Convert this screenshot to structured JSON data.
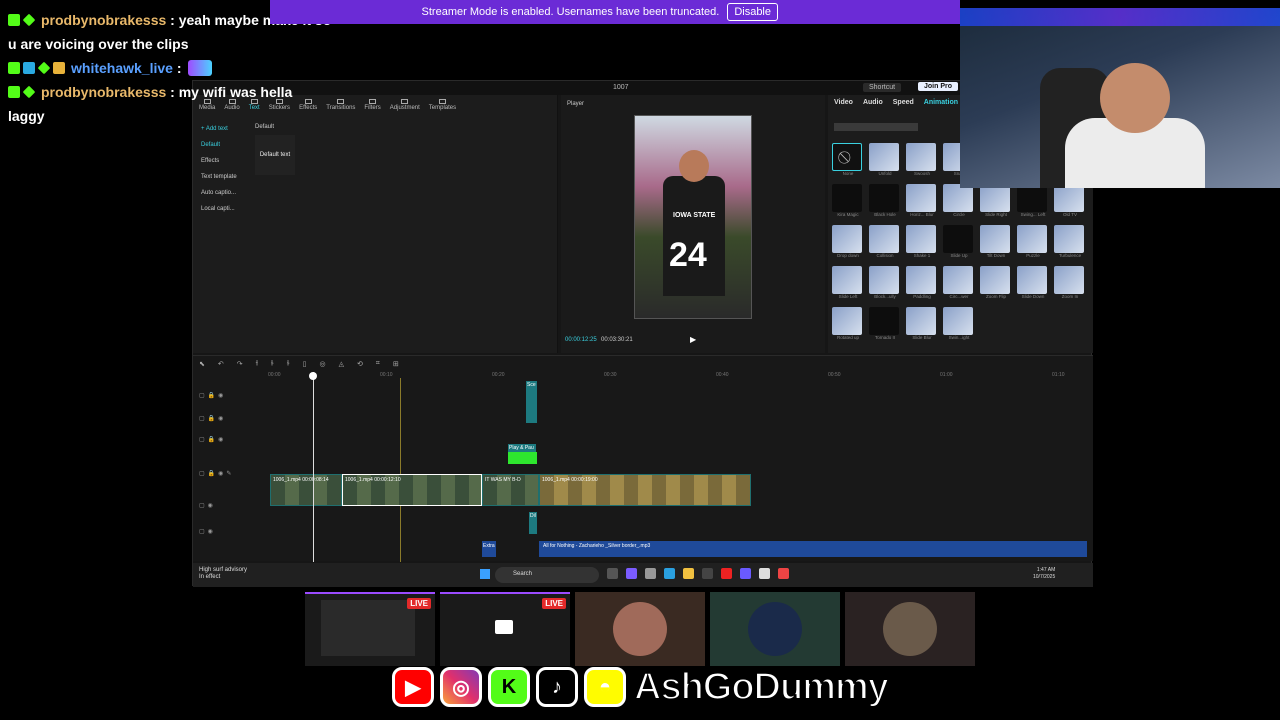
{
  "chat": {
    "messages": [
      {
        "user": "prodbynobrakesss",
        "text": "yeah maybe make it so"
      },
      {
        "user": "",
        "text": "u are voicing over the clips"
      },
      {
        "user": "whitehawk_live",
        "text": ""
      },
      {
        "user": "prodbynobrakesss",
        "text": "my wifi was hella"
      },
      {
        "user": "",
        "text": "laggy"
      }
    ]
  },
  "banner": {
    "text": "Streamer Mode is enabled. Usernames have been truncated.",
    "button": "Disable"
  },
  "editor": {
    "window_title": "1007",
    "shortcut_label": "Shortcut",
    "joinpro_label": "Join Pro",
    "media_tabs": [
      "Media",
      "Audio",
      "Text",
      "Stickers",
      "Effects",
      "Transitions",
      "Filters",
      "Adjustment",
      "Templates"
    ],
    "side_items": [
      "+ Add text",
      "Default",
      "Effects",
      "Text template",
      "Auto captio...",
      "Local capti..."
    ],
    "default_label": "Default",
    "default_tile": "Default text",
    "player_label": "Player",
    "video_jersey_text": "IOWA STATE",
    "video_number": "24",
    "time_current": "00:00:12:25",
    "time_total": "00:03:30:21",
    "anim_tabs": [
      "Video",
      "Audio",
      "Speed",
      "Animation"
    ],
    "anim_items": [
      "None",
      "Unfold",
      "Swoosh",
      "Snap",
      "Sticky Note",
      "Shake Slide",
      "Zoom 2",
      "Kira Magic",
      "Black Hole",
      "Horiz... Blur",
      "Circle",
      "Slide Right",
      "Swing... Left",
      "Old TV",
      "Drop down",
      "Collision",
      "Shake 1",
      "Slide Up",
      "Tilt Down",
      "Puzzle",
      "Turbulence",
      "Slide Left",
      "Block...ully",
      "Paddling",
      "Circ...wer",
      "Zoom Flip",
      "Slide Down",
      "Zoom In",
      "Rotated up",
      "Tornado II",
      "Slide Blur",
      "Swin...ight"
    ]
  },
  "timeline": {
    "ruler": [
      "00:00",
      "00:10",
      "00:20",
      "00:30",
      "00:40",
      "00:50",
      "01:00",
      "01:10"
    ],
    "clips": [
      {
        "label": "1006_1.mp4  00:00:08:14"
      },
      {
        "label": "1006_1.mp4  00:00:12:10"
      },
      {
        "label": "IT WAS MY B-D"
      },
      {
        "label": "1006_1.mp4  00:00:19:00"
      }
    ],
    "small_clips": [
      "Sce",
      "Play & Pau",
      "Dil",
      "Extra"
    ],
    "audio_label": "All for Nothing - Zacharieho _Silver border_.mp3"
  },
  "taskbar": {
    "weather_line1": "High surf advisory",
    "weather_line2": "In effect",
    "search_placeholder": "Search",
    "clock_time": "1:47 AM",
    "clock_date": "10/7/2025"
  },
  "scenes": {
    "live_label": "LIVE"
  },
  "socials": {
    "handle": "AshGoDummy"
  }
}
